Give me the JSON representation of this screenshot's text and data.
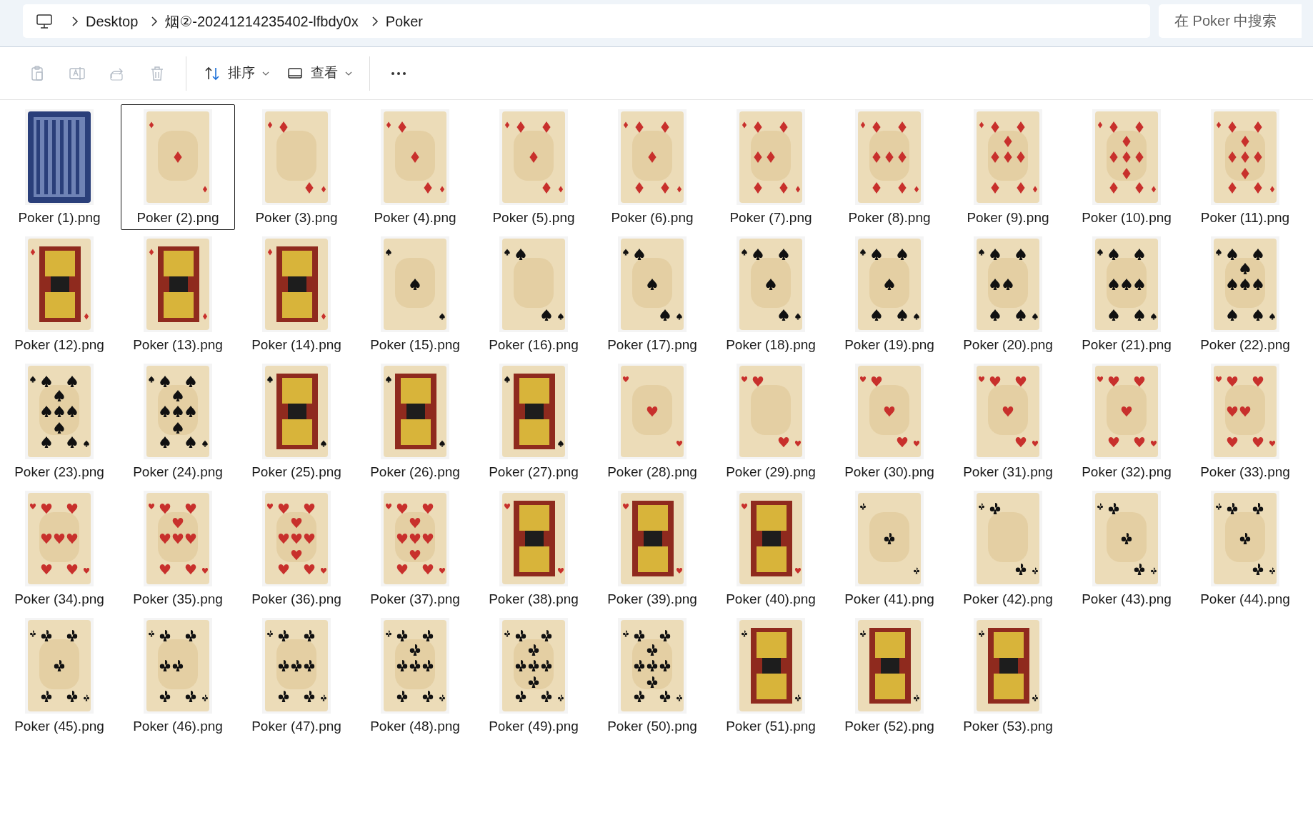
{
  "breadcrumb": {
    "segments": [
      "Desktop",
      "烟②-20241214235402-lfbdy0x",
      "Poker"
    ]
  },
  "search": {
    "placeholder": "在 Poker 中搜索"
  },
  "toolbar": [
    {
      "kind": "copy",
      "disabled": true
    },
    {
      "kind": "rename",
      "disabled": true
    },
    {
      "kind": "share",
      "disabled": true
    },
    {
      "kind": "delete",
      "disabled": true
    },
    {
      "kind": "sort",
      "label": "排序",
      "disabled": false
    },
    {
      "kind": "view",
      "label": "查看",
      "disabled": false
    },
    {
      "kind": "more",
      "disabled": false
    }
  ],
  "files": [
    {
      "name": "Poker (1).png",
      "selected": false
    },
    {
      "name": "Poker (2).png",
      "selected": true
    },
    {
      "name": "Poker (3).png",
      "selected": false
    },
    {
      "name": "Poker (4).png",
      "selected": false
    },
    {
      "name": "Poker (5).png",
      "selected": false
    },
    {
      "name": "Poker (6).png",
      "selected": false
    },
    {
      "name": "Poker (7).png",
      "selected": false
    },
    {
      "name": "Poker (8).png",
      "selected": false
    },
    {
      "name": "Poker (9).png",
      "selected": false
    },
    {
      "name": "Poker (10).png",
      "selected": false
    },
    {
      "name": "Poker (11).png",
      "selected": false
    },
    {
      "name": "Poker (12).png",
      "selected": false
    },
    {
      "name": "Poker (13).png",
      "selected": false
    },
    {
      "name": "Poker (14).png",
      "selected": false
    },
    {
      "name": "Poker (15).png",
      "selected": false
    },
    {
      "name": "Poker (16).png",
      "selected": false
    },
    {
      "name": "Poker (17).png",
      "selected": false
    },
    {
      "name": "Poker (18).png",
      "selected": false
    },
    {
      "name": "Poker (19).png",
      "selected": false
    },
    {
      "name": "Poker (20).png",
      "selected": false
    },
    {
      "name": "Poker (21).png",
      "selected": false
    },
    {
      "name": "Poker (22).png",
      "selected": false
    },
    {
      "name": "Poker (23).png",
      "selected": false
    },
    {
      "name": "Poker (24).png",
      "selected": false
    },
    {
      "name": "Poker (25).png",
      "selected": false
    },
    {
      "name": "Poker (26).png",
      "selected": false
    },
    {
      "name": "Poker (27).png",
      "selected": false
    },
    {
      "name": "Poker (28).png",
      "selected": false
    },
    {
      "name": "Poker (29).png",
      "selected": false
    },
    {
      "name": "Poker (30).png",
      "selected": false
    },
    {
      "name": "Poker (31).png",
      "selected": false
    },
    {
      "name": "Poker (32).png",
      "selected": false
    },
    {
      "name": "Poker (33).png",
      "selected": false
    },
    {
      "name": "Poker (34).png",
      "selected": false
    },
    {
      "name": "Poker (35).png",
      "selected": false
    },
    {
      "name": "Poker (36).png",
      "selected": false
    },
    {
      "name": "Poker (37).png",
      "selected": false
    },
    {
      "name": "Poker (38).png",
      "selected": false
    },
    {
      "name": "Poker (39).png",
      "selected": false
    },
    {
      "name": "Poker (40).png",
      "selected": false
    },
    {
      "name": "Poker (41).png",
      "selected": false
    },
    {
      "name": "Poker (42).png",
      "selected": false
    },
    {
      "name": "Poker (43).png",
      "selected": false
    },
    {
      "name": "Poker (44).png",
      "selected": false
    },
    {
      "name": "Poker (45).png",
      "selected": false
    },
    {
      "name": "Poker (46).png",
      "selected": false
    },
    {
      "name": "Poker (47).png",
      "selected": false
    },
    {
      "name": "Poker (48).png",
      "selected": false
    },
    {
      "name": "Poker (49).png",
      "selected": false
    },
    {
      "name": "Poker (50).png",
      "selected": false
    },
    {
      "name": "Poker (51).png",
      "selected": false
    },
    {
      "name": "Poker (52).png",
      "selected": false
    },
    {
      "name": "Poker (53).png",
      "selected": false
    }
  ]
}
